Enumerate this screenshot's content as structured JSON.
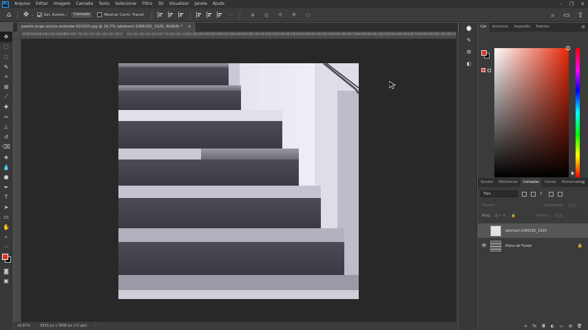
{
  "app": {
    "logo": "Ps",
    "menu": [
      "Arquivo",
      "Editar",
      "Imagem",
      "Camada",
      "Texto",
      "Selecionar",
      "Filtro",
      "3D",
      "Visualizar",
      "Janela",
      "Ajuda"
    ],
    "window_controls": [
      "–",
      "❐",
      "✕"
    ]
  },
  "options_bar": {
    "auto_select_label": "Sel. Autom.:",
    "auto_select_checked": true,
    "target_select": "Camada",
    "show_transform_label": "Mostrar Contr. Transf.",
    "show_transform_checked": false,
    "more": "···"
  },
  "document": {
    "tab_title": "pexels-jorge-arturo-andrade-921025.jpg @ 16,7% (abstract-1066182_1920, RGB/8) *",
    "close": "×",
    "ruler_ticks": [
      "1600",
      "1500",
      "1400",
      "1300",
      "1200",
      "1100",
      "1000",
      "900",
      "800",
      "700",
      "600",
      "500",
      "400",
      "300",
      "200",
      "100",
      "0",
      "100",
      "200",
      "300",
      "400",
      "500",
      "600",
      "700",
      "800",
      "900",
      "1000",
      "1100",
      "1200",
      "1300",
      "1400",
      "1500",
      "1600",
      "1700",
      "1800",
      "1900",
      "2000",
      "2100",
      "2200",
      "2300",
      "2400",
      "2500",
      "2600",
      "2700",
      "2800",
      "2900",
      "3000",
      "3100",
      "3200",
      "3300",
      "3400",
      "3500",
      "3600",
      "3700",
      "3800",
      "3900",
      "4000",
      "4100",
      "4200",
      "4300",
      "4400",
      "4500",
      "4600",
      "4700",
      "4800",
      "4900",
      "5000",
      "5100",
      "5200",
      "5300"
    ]
  },
  "status_bar": {
    "zoom": "16,67%",
    "doc_size": "3933 px x 3696 px (72 ppi)",
    "arrow": "›"
  },
  "color_panel": {
    "tabs": [
      "Cor",
      "Amostras",
      "Degradês",
      "Padrões"
    ],
    "active_tab": "Cor",
    "foreground": "#d9341f",
    "background": "#000000",
    "menu": "≡"
  },
  "layers_panel": {
    "tabs": [
      "Ajustes",
      "Bibliotecas",
      "Camadas",
      "Canais",
      "Demarcado"
    ],
    "active_tab": "Camadas",
    "kind_filter": "Tipo",
    "blend_mode": "Normal",
    "opacity_label": "Opacidade:",
    "lock_label": "Bloq.:",
    "fill_label": "Preenc.:",
    "layers": [
      {
        "name": "abstract-1066182_1920",
        "visible": false,
        "selected": true,
        "thumb": "checker"
      },
      {
        "name": "Plano de Fundo",
        "visible": true,
        "selected": false,
        "thumb": "stairs",
        "locked": true
      }
    ],
    "footer_icons": [
      "link-icon",
      "fx-icon",
      "mask-icon",
      "adjustment-icon",
      "group-icon",
      "new-layer-icon",
      "trash-icon"
    ],
    "menu": "≡"
  }
}
